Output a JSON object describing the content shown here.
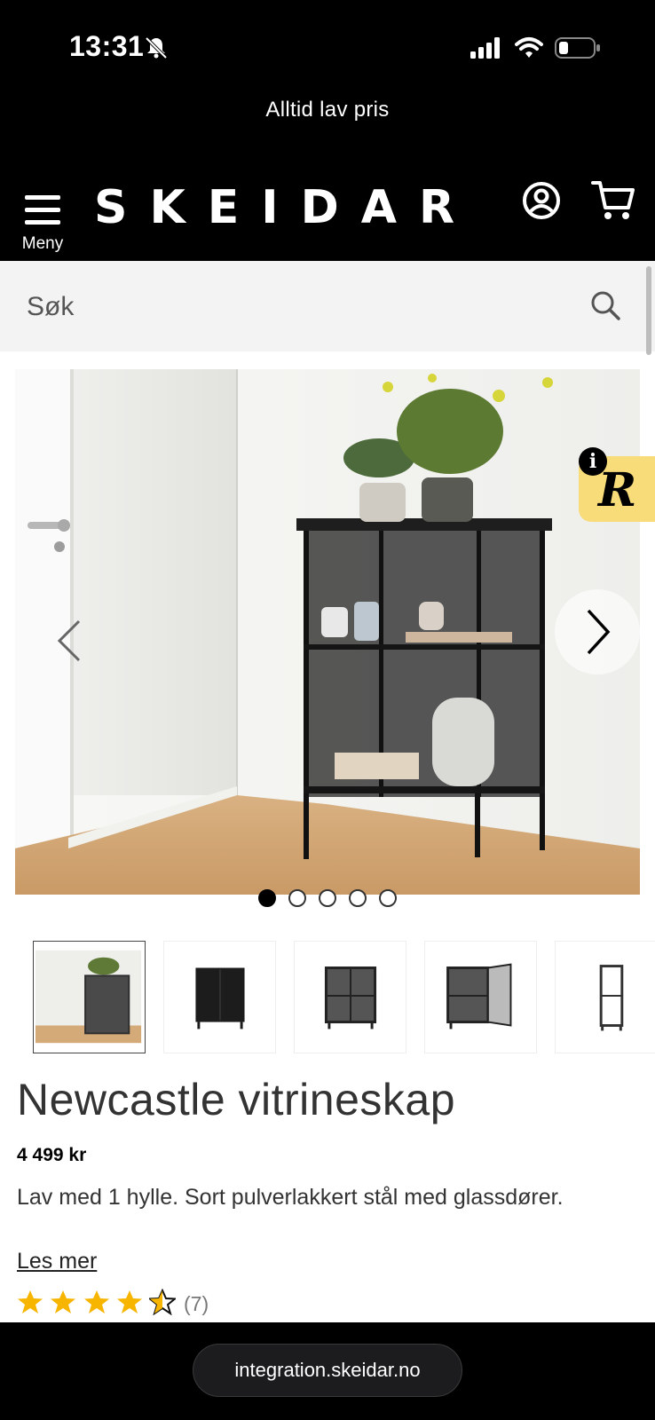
{
  "status_bar": {
    "time": "13:31"
  },
  "promo": {
    "text": "Alltid lav pris"
  },
  "header": {
    "menu_label": "Meny",
    "logo": "SKEIDAR",
    "icons": [
      "menu-icon",
      "account-icon",
      "cart-icon"
    ]
  },
  "search": {
    "placeholder": "Søk"
  },
  "gallery": {
    "total_images": 5,
    "active_index": 0,
    "badge_letter": "R",
    "info_symbol": "i"
  },
  "product": {
    "title": "Newcastle vitrineskap",
    "price": "4 499 kr",
    "description": "Lav med 1 hylle. Sort pulverlakkert stål med glassdører.",
    "read_more": "Les mer",
    "rating": 4.5,
    "rating_max": 5,
    "review_count": "(7)"
  },
  "browser": {
    "url": "integration.skeidar.no"
  },
  "colors": {
    "header_bg": "#000000",
    "search_bg": "#f3f3f3",
    "star": "#f7b500",
    "badge": "#f9dc7a"
  }
}
